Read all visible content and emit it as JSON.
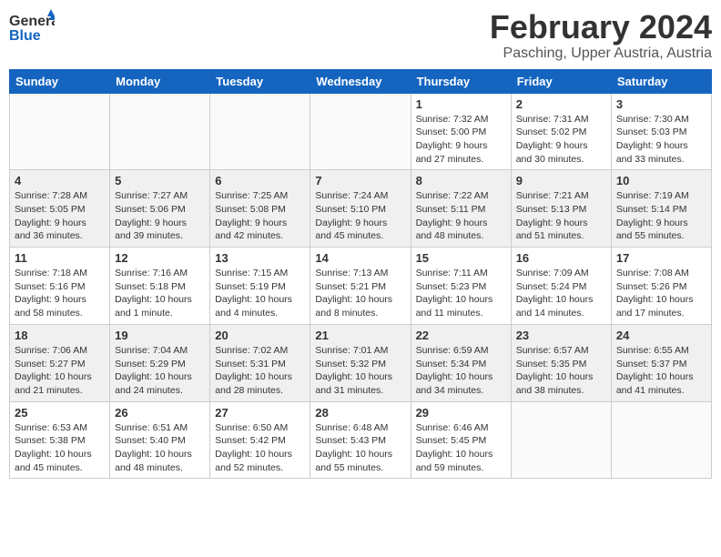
{
  "logo": {
    "text_general": "General",
    "text_blue": "Blue"
  },
  "header": {
    "title": "February 2024",
    "subtitle": "Pasching, Upper Austria, Austria"
  },
  "weekdays": [
    "Sunday",
    "Monday",
    "Tuesday",
    "Wednesday",
    "Thursday",
    "Friday",
    "Saturday"
  ],
  "weeks": [
    {
      "days": [
        {
          "num": "",
          "info": ""
        },
        {
          "num": "",
          "info": ""
        },
        {
          "num": "",
          "info": ""
        },
        {
          "num": "",
          "info": ""
        },
        {
          "num": "1",
          "info": "Sunrise: 7:32 AM\nSunset: 5:00 PM\nDaylight: 9 hours and 27 minutes."
        },
        {
          "num": "2",
          "info": "Sunrise: 7:31 AM\nSunset: 5:02 PM\nDaylight: 9 hours and 30 minutes."
        },
        {
          "num": "3",
          "info": "Sunrise: 7:30 AM\nSunset: 5:03 PM\nDaylight: 9 hours and 33 minutes."
        }
      ]
    },
    {
      "days": [
        {
          "num": "4",
          "info": "Sunrise: 7:28 AM\nSunset: 5:05 PM\nDaylight: 9 hours and 36 minutes."
        },
        {
          "num": "5",
          "info": "Sunrise: 7:27 AM\nSunset: 5:06 PM\nDaylight: 9 hours and 39 minutes."
        },
        {
          "num": "6",
          "info": "Sunrise: 7:25 AM\nSunset: 5:08 PM\nDaylight: 9 hours and 42 minutes."
        },
        {
          "num": "7",
          "info": "Sunrise: 7:24 AM\nSunset: 5:10 PM\nDaylight: 9 hours and 45 minutes."
        },
        {
          "num": "8",
          "info": "Sunrise: 7:22 AM\nSunset: 5:11 PM\nDaylight: 9 hours and 48 minutes."
        },
        {
          "num": "9",
          "info": "Sunrise: 7:21 AM\nSunset: 5:13 PM\nDaylight: 9 hours and 51 minutes."
        },
        {
          "num": "10",
          "info": "Sunrise: 7:19 AM\nSunset: 5:14 PM\nDaylight: 9 hours and 55 minutes."
        }
      ]
    },
    {
      "days": [
        {
          "num": "11",
          "info": "Sunrise: 7:18 AM\nSunset: 5:16 PM\nDaylight: 9 hours and 58 minutes."
        },
        {
          "num": "12",
          "info": "Sunrise: 7:16 AM\nSunset: 5:18 PM\nDaylight: 10 hours and 1 minute."
        },
        {
          "num": "13",
          "info": "Sunrise: 7:15 AM\nSunset: 5:19 PM\nDaylight: 10 hours and 4 minutes."
        },
        {
          "num": "14",
          "info": "Sunrise: 7:13 AM\nSunset: 5:21 PM\nDaylight: 10 hours and 8 minutes."
        },
        {
          "num": "15",
          "info": "Sunrise: 7:11 AM\nSunset: 5:23 PM\nDaylight: 10 hours and 11 minutes."
        },
        {
          "num": "16",
          "info": "Sunrise: 7:09 AM\nSunset: 5:24 PM\nDaylight: 10 hours and 14 minutes."
        },
        {
          "num": "17",
          "info": "Sunrise: 7:08 AM\nSunset: 5:26 PM\nDaylight: 10 hours and 17 minutes."
        }
      ]
    },
    {
      "days": [
        {
          "num": "18",
          "info": "Sunrise: 7:06 AM\nSunset: 5:27 PM\nDaylight: 10 hours and 21 minutes."
        },
        {
          "num": "19",
          "info": "Sunrise: 7:04 AM\nSunset: 5:29 PM\nDaylight: 10 hours and 24 minutes."
        },
        {
          "num": "20",
          "info": "Sunrise: 7:02 AM\nSunset: 5:31 PM\nDaylight: 10 hours and 28 minutes."
        },
        {
          "num": "21",
          "info": "Sunrise: 7:01 AM\nSunset: 5:32 PM\nDaylight: 10 hours and 31 minutes."
        },
        {
          "num": "22",
          "info": "Sunrise: 6:59 AM\nSunset: 5:34 PM\nDaylight: 10 hours and 34 minutes."
        },
        {
          "num": "23",
          "info": "Sunrise: 6:57 AM\nSunset: 5:35 PM\nDaylight: 10 hours and 38 minutes."
        },
        {
          "num": "24",
          "info": "Sunrise: 6:55 AM\nSunset: 5:37 PM\nDaylight: 10 hours and 41 minutes."
        }
      ]
    },
    {
      "days": [
        {
          "num": "25",
          "info": "Sunrise: 6:53 AM\nSunset: 5:38 PM\nDaylight: 10 hours and 45 minutes."
        },
        {
          "num": "26",
          "info": "Sunrise: 6:51 AM\nSunset: 5:40 PM\nDaylight: 10 hours and 48 minutes."
        },
        {
          "num": "27",
          "info": "Sunrise: 6:50 AM\nSunset: 5:42 PM\nDaylight: 10 hours and 52 minutes."
        },
        {
          "num": "28",
          "info": "Sunrise: 6:48 AM\nSunset: 5:43 PM\nDaylight: 10 hours and 55 minutes."
        },
        {
          "num": "29",
          "info": "Sunrise: 6:46 AM\nSunset: 5:45 PM\nDaylight: 10 hours and 59 minutes."
        },
        {
          "num": "",
          "info": ""
        },
        {
          "num": "",
          "info": ""
        }
      ]
    }
  ]
}
